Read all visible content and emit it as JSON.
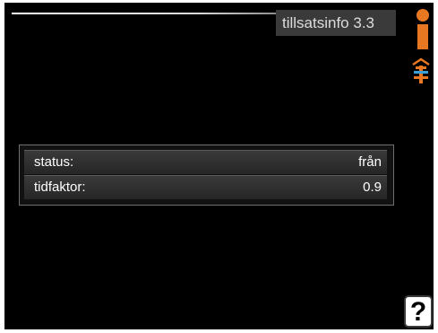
{
  "header": {
    "title": "tillsatsinfo",
    "menu_number": "3.3"
  },
  "icons": {
    "info": "info-icon",
    "addon": "addon-heater-icon",
    "help": "help-icon"
  },
  "info_rows": [
    {
      "label": "status:",
      "value": "från"
    },
    {
      "label": "tidfaktor:",
      "value": "0.9"
    }
  ],
  "help": {
    "label": "?"
  },
  "colors": {
    "background": "#000000",
    "accent_orange": "#e87722",
    "addon_blue": "#3aa0d8",
    "title_bar": "#3a3a3a"
  }
}
